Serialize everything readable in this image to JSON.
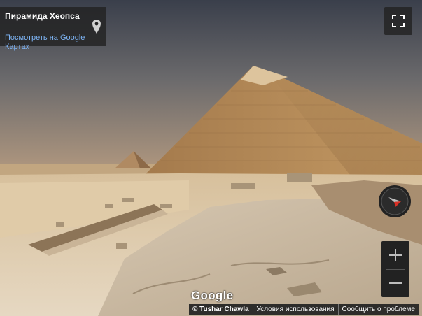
{
  "info_card": {
    "title": "Пирамида Хеопса",
    "maps_link_line1": "Посмотреть на Google",
    "maps_link_line2": "Картах"
  },
  "icons": {
    "pin": "map-pin-icon",
    "fullscreen": "fullscreen-icon",
    "compass": "compass-icon",
    "zoom_in": "zoom-in-icon",
    "zoom_out": "zoom-out-icon"
  },
  "logo": "Google",
  "footer": {
    "copyright": "© Tushar Chawla",
    "terms": "Условия использования",
    "report": "Сообщить о проблеме"
  },
  "colors": {
    "link": "#7eb4f6",
    "panel": "#222222",
    "compass_north": "#d93025"
  }
}
